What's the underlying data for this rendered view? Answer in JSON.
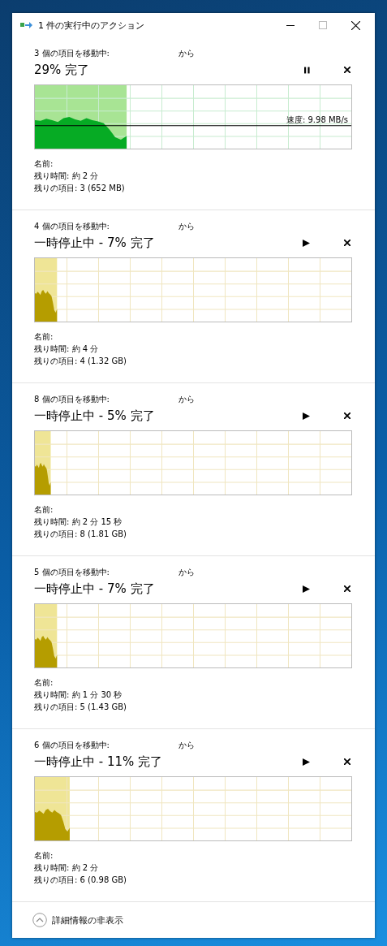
{
  "window": {
    "title": "1 件の実行中のアクション"
  },
  "operations": [
    {
      "heading": "3 個の項目を移動中:",
      "from_label": "から",
      "status": "29% 完了",
      "paused": false,
      "level": 0.29,
      "speed": "速度: 9.98 MB/s",
      "name_label": "名前:",
      "time_left": "残り時間: 約 2 分",
      "items_left": "残りの項目: 3 (652 MB)"
    },
    {
      "heading": "4 個の項目を移動中:",
      "from_label": "から",
      "status": "一時停止中 - 7% 完了",
      "paused": true,
      "level": 0.07,
      "name_label": "名前:",
      "time_left": "残り時間: 約 4 分",
      "items_left": "残りの項目: 4 (1.32 GB)"
    },
    {
      "heading": "8 個の項目を移動中:",
      "from_label": "から",
      "status": "一時停止中 - 5% 完了",
      "paused": true,
      "level": 0.05,
      "name_label": "名前:",
      "time_left": "残り時間: 約 2 分 15 秒",
      "items_left": "残りの項目: 8 (1.81 GB)"
    },
    {
      "heading": "5 個の項目を移動中:",
      "from_label": "から",
      "status": "一時停止中 - 7% 完了",
      "paused": true,
      "level": 0.07,
      "name_label": "名前:",
      "time_left": "残り時間: 約 1 分 30 秒",
      "items_left": "残りの項目: 5 (1.43 GB)"
    },
    {
      "heading": "6 個の項目を移動中:",
      "from_label": "から",
      "status": "一時停止中 - 11% 完了",
      "paused": true,
      "level": 0.11,
      "name_label": "名前:",
      "time_left": "残り時間: 約 2 分",
      "items_left": "残りの項目: 6 (0.98 GB)"
    }
  ],
  "footer": {
    "toggle_label": "詳細情報の非表示"
  }
}
